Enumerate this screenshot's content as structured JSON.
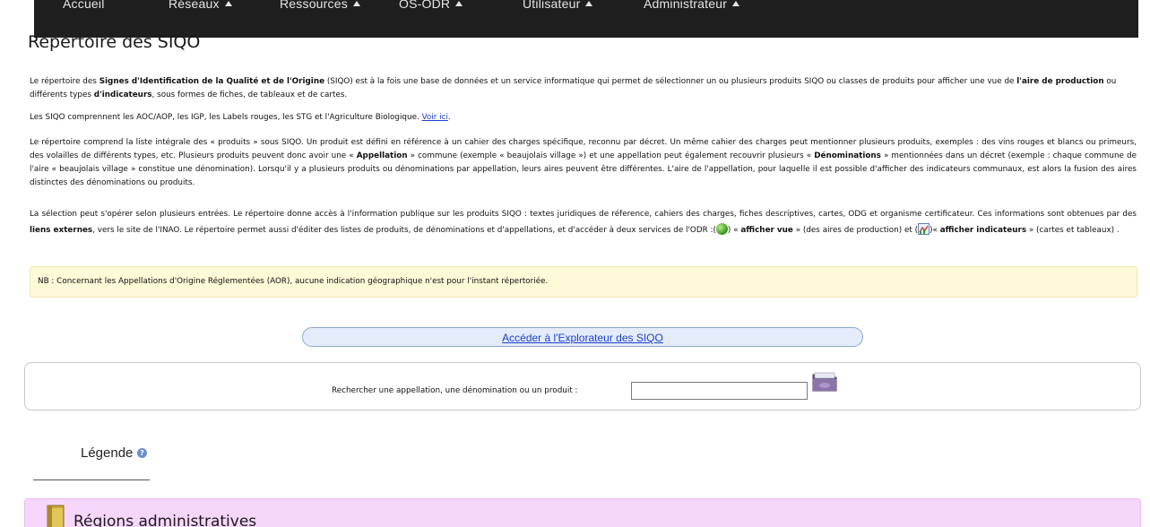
{
  "nav": {
    "items": [
      {
        "label": "Accueil",
        "has_caret": false
      },
      {
        "label": "Réseaux",
        "has_caret": true
      },
      {
        "label": "Ressources",
        "has_caret": true
      },
      {
        "label": "OS-ODR",
        "has_caret": true
      },
      {
        "label": "Utilisateur",
        "has_caret": true
      },
      {
        "label": "Administrateur",
        "has_caret": true
      }
    ]
  },
  "page": {
    "title": "Répertoire des SIQO"
  },
  "intro": {
    "p1_a": "Le répertoire des ",
    "p1_b": "Signes d'Identification de la Qualité et de l'Origine",
    "p1_c": " (SIQO) est à la fois une base de données et un service informatique qui permet de sélectionner un ou plusieurs produits SIQO ou classes de produits pour afficher une vue de ",
    "p1_d": "l'aire de production",
    "p1_e": " ou différents types ",
    "p1_f": "d'indicateurs",
    "p1_g": ", sous formes de fiches, de tableaux et de cartes.",
    "p2_a": "Les SIQO comprennent les AOC/AOP, les IGP, les Labels rouges, les STG et l'Agriculture Biologique. ",
    "p2_link": "Voir ici",
    "p2_b": ".",
    "p3_a": "Le répertoire comprend la liste intégrale des « produits » sous SIQO. Un produit est défini en référence à un cahier des charges spécifique, reconnu par décret. Un même cahier des charges peut mentionner plusieurs produits, exemples : des vins rouges et blancs ou primeurs, des volailles de différents types, etc. Plusieurs produits peuvent donc avoir une « ",
    "p3_b": "Appellation",
    "p3_c": " » commune (exemple « beaujolais village ») et une appellation peut également recouvrir plusieurs « ",
    "p3_d": "Dénominations",
    "p3_e": " » mentionnées dans un décret (exemple : chaque commune de l'aire « beaujolais village » constitue une dénomination). Lorsqu'il y a plusieurs produits ou dénominations par appellation, leurs aires peuvent être différentes. L'aire de l'appellation, pour laquelle il est possible d'afficher des indicateurs communaux, est alors la fusion des aires distinctes des dénominations ou produits.",
    "p4_a": "La sélection peut s'opérer selon plusieurs entrées. Le répertoire donne accès à l'information publique sur les produits SIQO : textes juridiques de réference, cahiers des charges, fiches descriptives, cartes, ODG et organisme certificateur. Ces informations sont obtenues par des ",
    "p4_b": "liens externes",
    "p4_c": ", vers le site de l'INAO. Le répertoire permet aussi d'éditer des listes de produits, de dénominations et d'appellations, et d'accéder à deux services de l'ODR :(",
    "p4_d": ") « ",
    "p4_e": "afficher vue",
    "p4_f": " » (des aires de production) et (",
    "p4_g": ")« ",
    "p4_h": "afficher indicateurs",
    "p4_i": " » (cartes et tableaux) ."
  },
  "nb": {
    "text": "NB : Concernant les Appellations d'Origine Réglementées (AOR), aucune indication géographique n'est pour l'instant répertoriée."
  },
  "explorer": {
    "link_label": "Accéder à l'Explorateur des SIQO"
  },
  "search": {
    "label": "Rechercher une appellation, une dénomination ou un produit :",
    "value": "",
    "placeholder": ""
  },
  "legend": {
    "title": "Légende"
  },
  "regions": {
    "label": "Régions administratives"
  },
  "colors": {
    "nav_bg": "#1f1f1f",
    "nb_bg": "#fef9d7",
    "explorer_bg": "#e4ecfa",
    "regions_bg": "#f7d6fb",
    "link": "#1b3fd1"
  },
  "icons": [
    "caret-up-icon",
    "globe-icon",
    "chart-icon",
    "folder-search-icon",
    "help-icon",
    "folder-icon"
  ]
}
